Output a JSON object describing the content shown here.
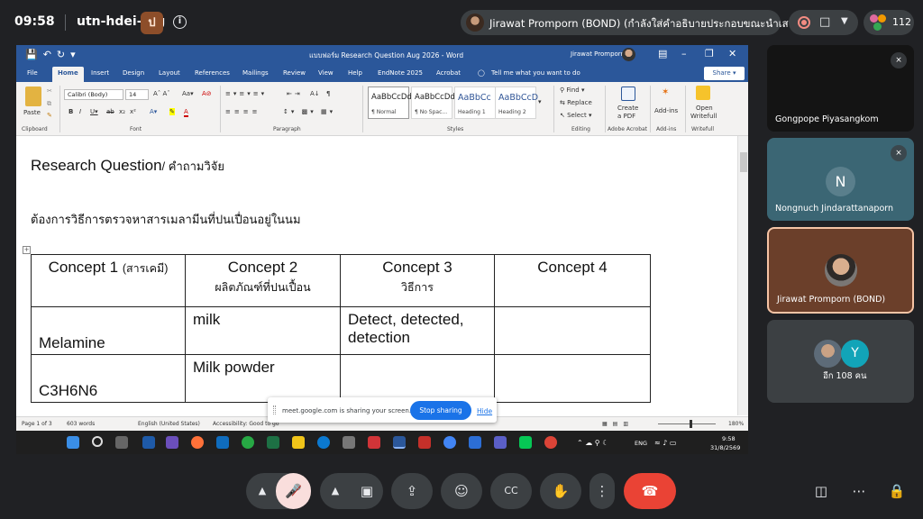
{
  "meet": {
    "time": "09:58",
    "meeting_code": "utn-hdei-fog",
    "badge_letter": "ป",
    "presenter_text": "Jirawat Promporn (BOND) (กำลังใส่คำอธิบายประกอบขณะนำเสนอ)",
    "participant_count": "112",
    "share_message": "meet.google.com is sharing your screen.",
    "stop_sharing": "Stop sharing",
    "hide": "Hide"
  },
  "word": {
    "doc_title": "แบบฟอร์ม Research Question Aug 2026  -  Word",
    "user": "Jirawat Promporn",
    "tabs": [
      "File",
      "Home",
      "Insert",
      "Design",
      "Layout",
      "References",
      "Mailings",
      "Review",
      "View",
      "Help",
      "EndNote 2025",
      "Acrobat"
    ],
    "tell_me": "Tell me what you want to do",
    "share": "Share",
    "ribbon": {
      "paste": "Paste",
      "font_name": "Calibri (Body)",
      "font_size": "14",
      "groups": [
        "Clipboard",
        "Font",
        "Paragraph",
        "Styles",
        "Editing",
        "Adobe Acrobat",
        "Add-ins",
        "Writefull"
      ],
      "styles": [
        {
          "preview": "AaBbCcDd",
          "name": "¶ Normal"
        },
        {
          "preview": "AaBbCcDd",
          "name": "¶ No Spac..."
        },
        {
          "preview": "AaBbCc",
          "name": "Heading 1"
        },
        {
          "preview": "AaBbCcD",
          "name": "Heading 2"
        }
      ],
      "find": "Find",
      "replace": "Replace",
      "select": "Select",
      "create_pdf_1": "Create",
      "create_pdf_2": "a PDF",
      "addins": "Add-ins",
      "writefull_1": "Open",
      "writefull_2": "Writefull"
    },
    "heading_en": "Research Question",
    "heading_th": "/ คำถามวิจัย",
    "question": "ต้องการวิธีการตรวจหาสารเมลามีนที่ปนเปื่อนอยู่ในนม",
    "table": {
      "headers": [
        {
          "title": "Concept 1 ",
          "th": "(สารเคมี)"
        },
        {
          "title": "Concept 2",
          "th": "ผลิตภัณฑ์ที่ปนเปื้อน"
        },
        {
          "title": "Concept 3",
          "th": "วิธีการ"
        },
        {
          "title": "Concept 4",
          "th": ""
        }
      ],
      "rows": [
        [
          "Melamine",
          "milk",
          "Detect, detected, detection",
          ""
        ],
        [
          "C3H6N6",
          "Milk powder",
          "",
          ""
        ]
      ]
    },
    "status": {
      "page": "Page 1 of 3",
      "words": "603 words",
      "lang": "English (United States)",
      "access": "Accessibility: Good to go",
      "zoom": "180%"
    },
    "taskbar": {
      "lang": "ENG",
      "time": "9:58",
      "date": "31/8/2569"
    }
  },
  "participants": [
    {
      "name": "Gongpope Piyasangkom"
    },
    {
      "name": "Nongnuch Jindarattanaporn",
      "initial": "N"
    },
    {
      "name": "Jirawat Promporn (BOND)"
    },
    {
      "name": "อีก 108 คน",
      "initial": "Y"
    }
  ],
  "colors": {
    "meet_bg": "#202124",
    "word_blue": "#2b579a",
    "end_call": "#ea4335",
    "mic_off": "#f9dedc",
    "accent_blue": "#1a73e8"
  }
}
